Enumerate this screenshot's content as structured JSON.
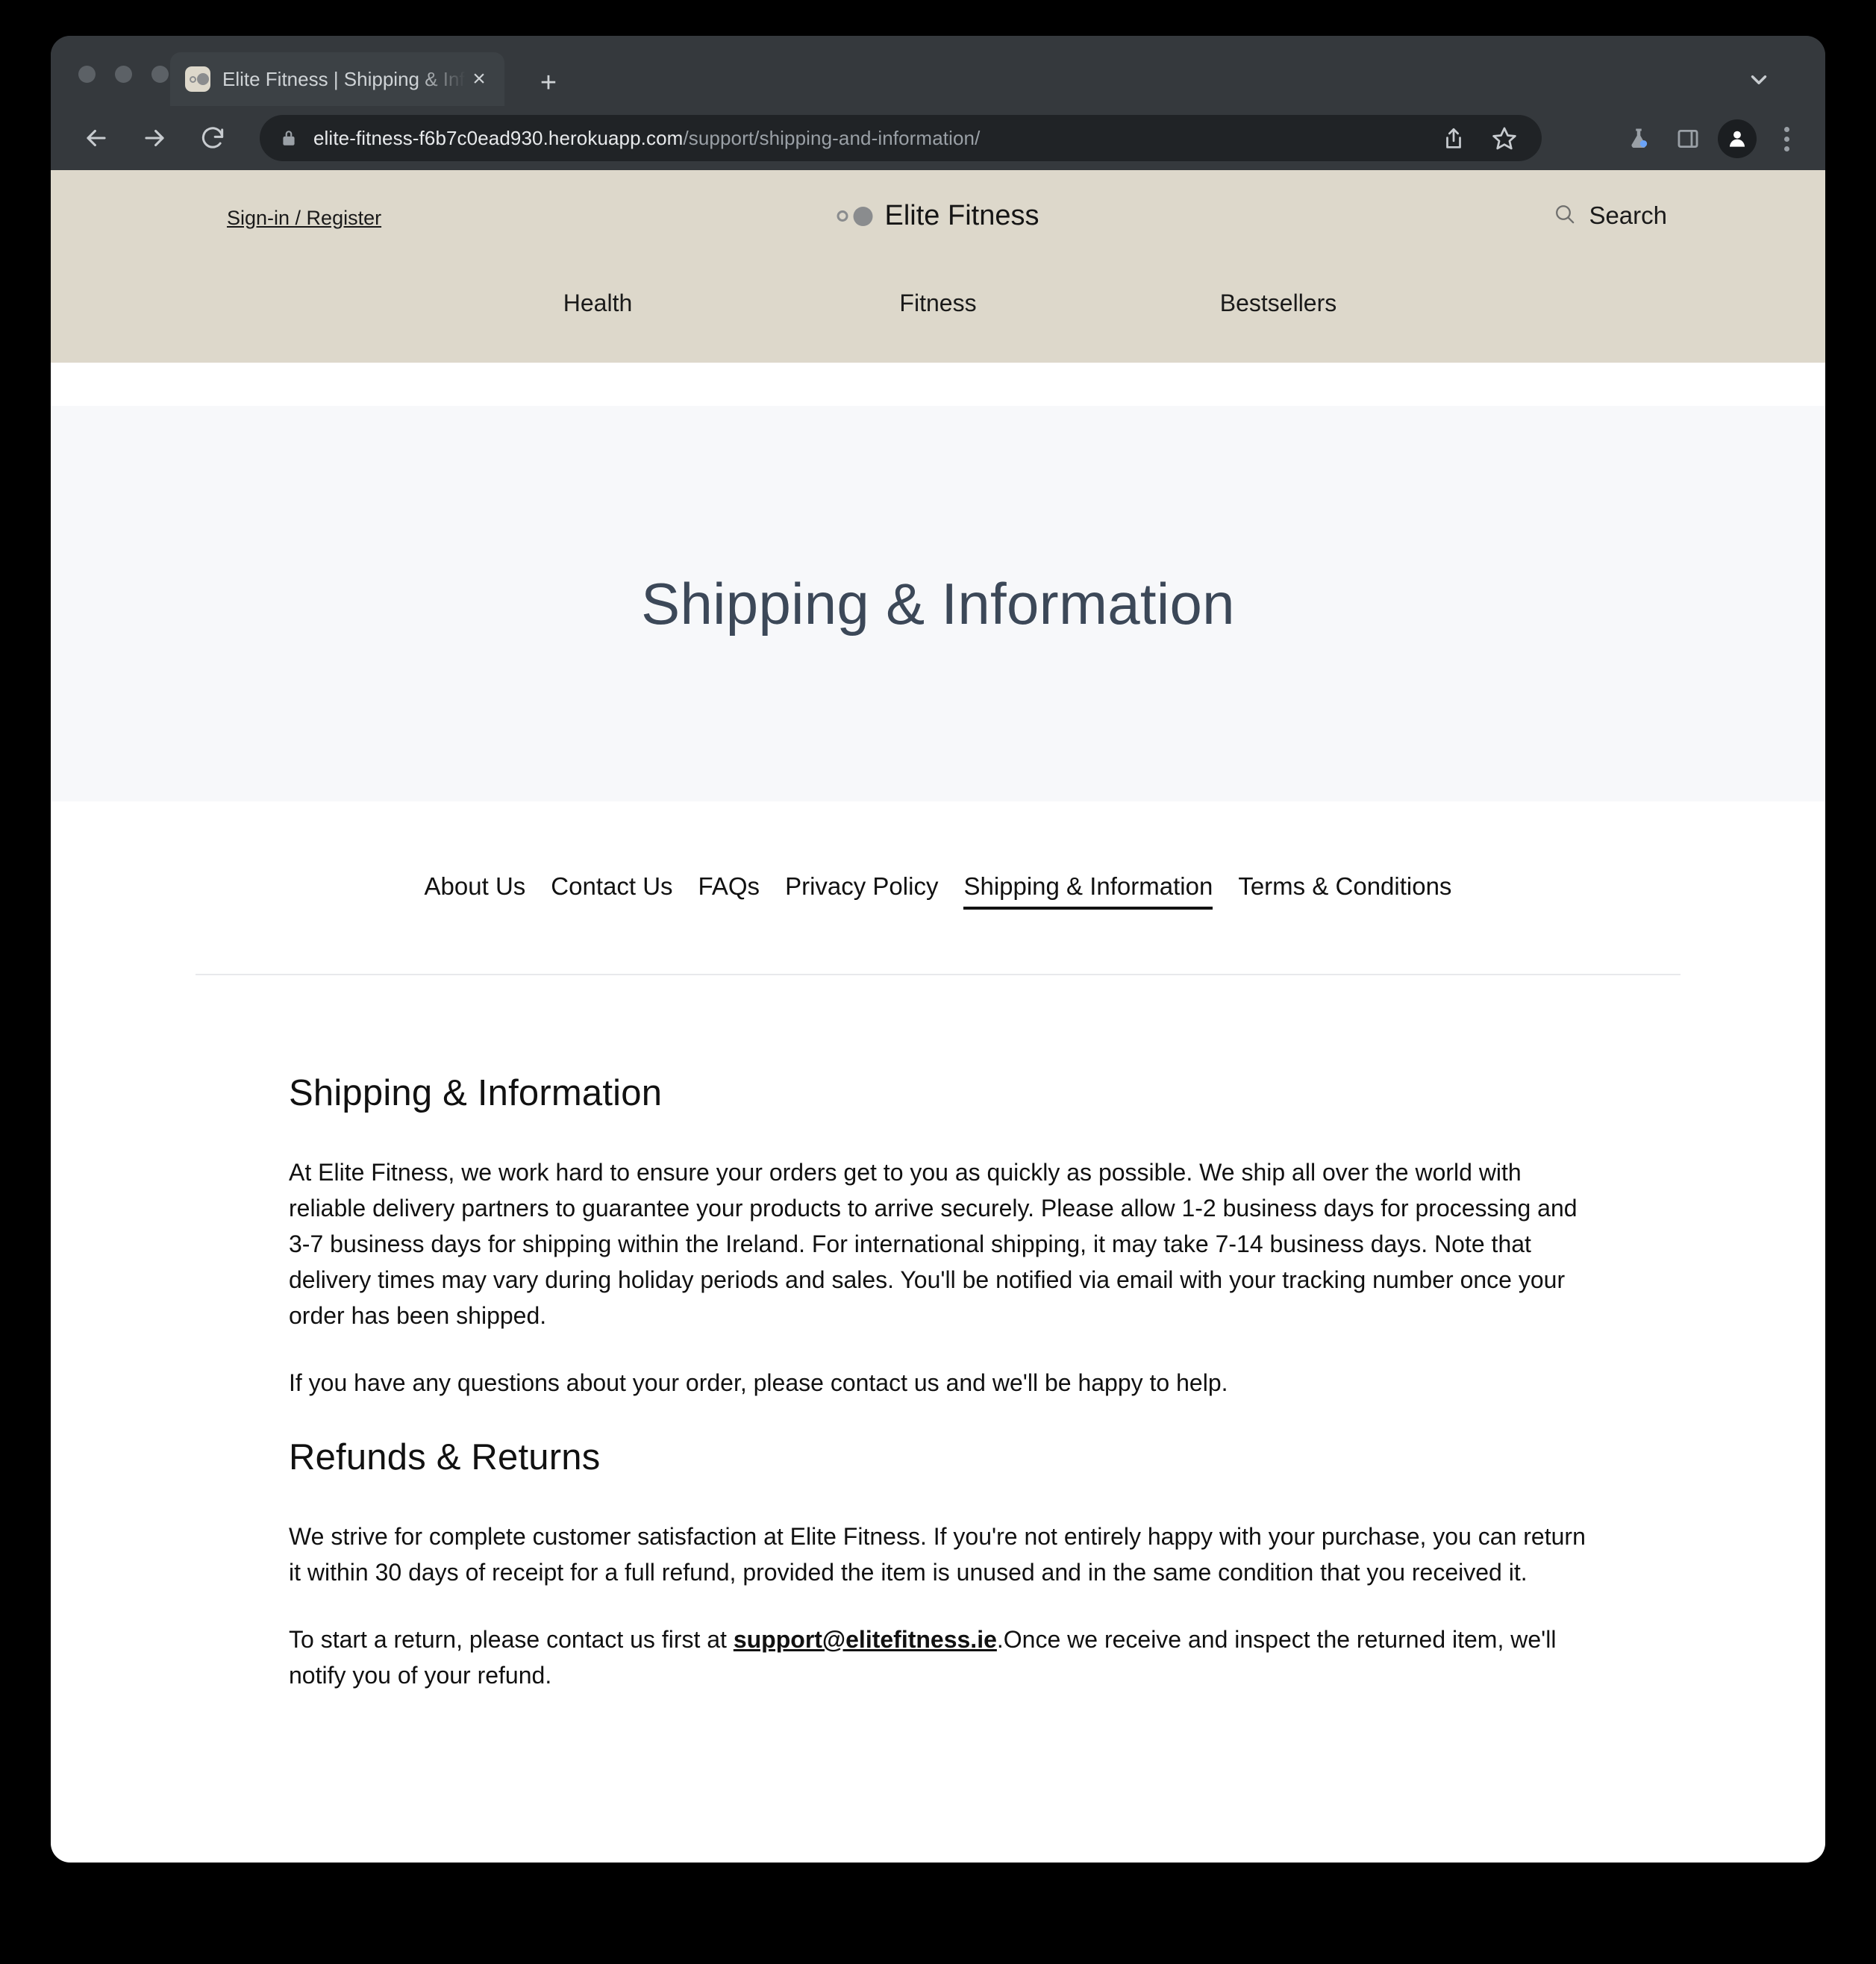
{
  "browser": {
    "tab": {
      "title": "Elite Fitness | Shipping & Infor",
      "close_label": "×",
      "favicon_name": "elite-fitness-favicon"
    },
    "newtab_label": "+",
    "url": {
      "domain": "elite-fitness-f6b7c0ead930.herokuapp.com",
      "path": "/support/shipping-and-information/"
    },
    "icons": {
      "back": "back-arrow-icon",
      "forward": "forward-arrow-icon",
      "reload": "reload-icon",
      "lock": "lock-icon",
      "share": "share-icon",
      "bookmark": "star-icon",
      "experiments": "flask-icon",
      "side_panel": "side-panel-icon",
      "profile": "profile-avatar-icon",
      "menu": "kebab-menu-icon",
      "tab_list": "chevron-down-icon"
    }
  },
  "site": {
    "header": {
      "signin": "Sign-in / Register",
      "brand": "Elite Fitness",
      "search": "Search",
      "nav": [
        {
          "label": "Health"
        },
        {
          "label": "Fitness"
        },
        {
          "label": "Bestsellers"
        }
      ]
    },
    "hero": {
      "title": "Shipping & Information"
    },
    "subnav": [
      {
        "label": "About Us",
        "active": false
      },
      {
        "label": "Contact Us",
        "active": false
      },
      {
        "label": "FAQs",
        "active": false
      },
      {
        "label": "Privacy Policy",
        "active": false
      },
      {
        "label": "Shipping & Information",
        "active": true
      },
      {
        "label": "Terms & Conditions",
        "active": false
      }
    ],
    "article": {
      "heading_1": "Shipping & Information",
      "paragraph_1": "At Elite Fitness, we work hard to ensure your orders get to you as quickly as possible. We ship all over the world with reliable delivery partners to guarantee your products to arrive securely. Please allow 1-2 business days for processing and 3-7 business days for shipping within the Ireland. For international shipping, it may take 7-14 business days. Note that delivery times may vary during holiday periods and sales. You'll be notified via email with your tracking number once your order has been shipped.",
      "paragraph_2": "If you have any questions about your order, please contact us and we'll be happy to help.",
      "heading_2": "Refunds & Returns",
      "paragraph_3": "We strive for complete customer satisfaction at Elite Fitness. If you're not entirely happy with your purchase, you can return it within 30 days of receipt for a full refund, provided the item is unused and in the same condition that you received it.",
      "paragraph_4_before": "To start a return, please contact us first at ",
      "paragraph_4_link": "support@elitefitness.ie",
      "paragraph_4_after": ".Once we receive and inspect the returned item, we'll notify you of your refund."
    }
  },
  "colors": {
    "header_bg": "#ddd8cb",
    "hero_bg": "#f7f8fa",
    "hero_title": "#3c4858",
    "browser_chrome": "#35393d",
    "omnibox_bg": "#202326"
  }
}
